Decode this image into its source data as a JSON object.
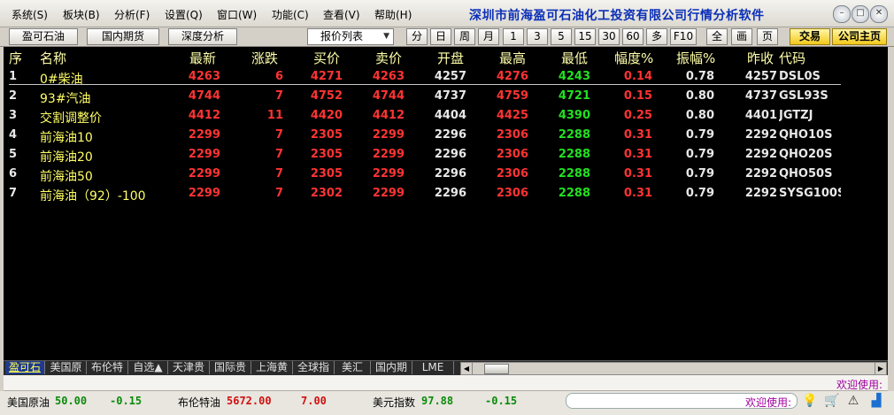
{
  "menu": [
    "系统(S)",
    "板块(B)",
    "分析(F)",
    "设置(Q)",
    "窗口(W)",
    "功能(C)",
    "查看(V)",
    "帮助(H)"
  ],
  "app_title": "深圳市前海盈可石油化工投资有限公司行情分析软件",
  "window_controls": {
    "minimize": "–",
    "restore": "□",
    "close": "✕"
  },
  "toolbar": {
    "left_buttons": [
      "盈可石油",
      "国内期货",
      "深度分析"
    ],
    "dropdown": "报价列表",
    "periods": [
      "分",
      "日",
      "周",
      "月",
      "1",
      "3",
      "5",
      "15",
      "30",
      "60",
      "多",
      "F10",
      "全",
      "画",
      "页"
    ],
    "trade": "交易",
    "home": "公司主页"
  },
  "table": {
    "headers": [
      "序",
      "名称",
      "最新",
      "涨跌",
      "买价",
      "卖价",
      "开盘",
      "最高",
      "最低",
      "幅度%",
      "振幅%",
      "昨收",
      "代码"
    ],
    "rows": [
      {
        "no": "1",
        "name": "0#柴油",
        "last": "4263",
        "chg": "6",
        "bid": "4271",
        "ask": "4263",
        "open": "4257",
        "high": "4276",
        "low": "4243",
        "pct": "0.14",
        "amp": "0.78",
        "prev": "4257",
        "code": "DSL0S"
      },
      {
        "no": "2",
        "name": "93#汽油",
        "last": "4744",
        "chg": "7",
        "bid": "4752",
        "ask": "4744",
        "open": "4737",
        "high": "4759",
        "low": "4721",
        "pct": "0.15",
        "amp": "0.80",
        "prev": "4737",
        "code": "GSL93S"
      },
      {
        "no": "3",
        "name": "交割调整价",
        "last": "4412",
        "chg": "11",
        "bid": "4420",
        "ask": "4412",
        "open": "4404",
        "high": "4425",
        "low": "4390",
        "pct": "0.25",
        "amp": "0.80",
        "prev": "4401",
        "code": "JGTZJ"
      },
      {
        "no": "4",
        "name": "前海油10",
        "last": "2299",
        "chg": "7",
        "bid": "2305",
        "ask": "2299",
        "open": "2296",
        "high": "2306",
        "low": "2288",
        "pct": "0.31",
        "amp": "0.79",
        "prev": "2292",
        "code": "QHO10S"
      },
      {
        "no": "5",
        "name": "前海油20",
        "last": "2299",
        "chg": "7",
        "bid": "2305",
        "ask": "2299",
        "open": "2296",
        "high": "2306",
        "low": "2288",
        "pct": "0.31",
        "amp": "0.79",
        "prev": "2292",
        "code": "QHO20S"
      },
      {
        "no": "6",
        "name": "前海油50",
        "last": "2299",
        "chg": "7",
        "bid": "2305",
        "ask": "2299",
        "open": "2296",
        "high": "2306",
        "low": "2288",
        "pct": "0.31",
        "amp": "0.79",
        "prev": "2292",
        "code": "QHO50S"
      },
      {
        "no": "7",
        "name": "前海油（92）-100",
        "last": "2299",
        "chg": "7",
        "bid": "2302",
        "ask": "2299",
        "open": "2296",
        "high": "2306",
        "low": "2288",
        "pct": "0.31",
        "amp": "0.79",
        "prev": "2292",
        "code": "SYSG100S"
      }
    ]
  },
  "tabs": [
    "盈可石",
    "美国原",
    "布伦特",
    "自选▲",
    "天津贵",
    "国际贵",
    "上海黄",
    "全球指",
    "美汇",
    "国内期",
    "LME"
  ],
  "welcome_text": "欢迎使用:",
  "status": {
    "items": [
      {
        "label": "美国原油",
        "value": "50.00",
        "change": "-0.15"
      },
      {
        "label": "布伦特油",
        "value": "5672.00",
        "change": "7.00"
      },
      {
        "label": "美元指数",
        "value": "97.88",
        "change": "-0.15"
      }
    ],
    "welcome": "欢迎使用:",
    "icons": [
      "lightbulb-icon",
      "cart-icon",
      "warning-icon",
      "signal-icon"
    ]
  },
  "colors": {
    "up": "#ff3333",
    "down": "#22e022",
    "header": "#ffffaa",
    "accent": "#0a2fb8"
  }
}
